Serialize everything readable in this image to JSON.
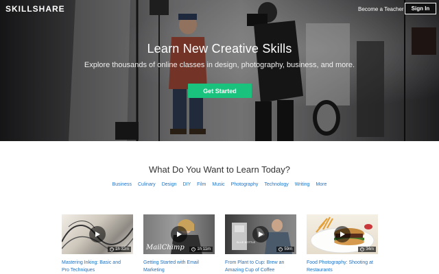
{
  "header": {
    "brand": "SKILLSHARE",
    "teacher_link": "Become a Teacher",
    "signin_label": "Sign In"
  },
  "hero": {
    "title": "Learn New Creative Skills",
    "subtitle": "Explore thousands of online classes in design, photography, business, and more.",
    "cta_label": "Get Started"
  },
  "learn": {
    "title": "What Do You Want to Learn Today?",
    "categories": [
      "Business",
      "Culinary",
      "Design",
      "DIY",
      "Film",
      "Music",
      "Photography",
      "Technology",
      "Writing",
      "More"
    ]
  },
  "classes": [
    {
      "title_line1": "Mastering Inking: Basic and",
      "title_line2": "Pro Techniques",
      "duration": "1h 32m",
      "thumb_text": ""
    },
    {
      "title_line1": "Getting Started with Email",
      "title_line2": "Marketing",
      "duration": "1h 11m",
      "thumb_text": "MailChimp"
    },
    {
      "title_line1": "From Plant to Cup: Brew an",
      "title_line2": "Amazing Cup of Coffee",
      "duration": "59m",
      "thumb_text": "BLUE BOTTLE"
    },
    {
      "title_line1": "Food Photography: Shooting at",
      "title_line2": "Restaurants",
      "duration": "34m",
      "thumb_text": ""
    }
  ],
  "colors": {
    "accent_green": "#19c37d",
    "link_blue": "#1a73c9"
  }
}
